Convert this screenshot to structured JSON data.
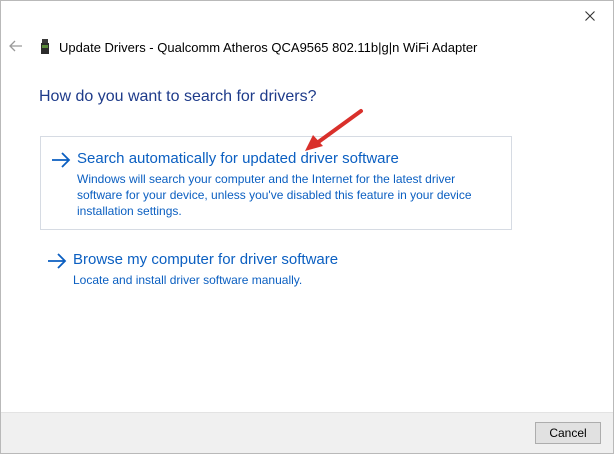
{
  "window": {
    "title": "Update Drivers - Qualcomm Atheros QCA9565 802.11b|g|n WiFi Adapter"
  },
  "heading": "How do you want to search for drivers?",
  "options": [
    {
      "title": "Search automatically for updated driver software",
      "description": "Windows will search your computer and the Internet for the latest driver software for your device, unless you've disabled this feature in your device installation settings."
    },
    {
      "title": "Browse my computer for driver software",
      "description": "Locate and install driver software manually."
    }
  ],
  "footer": {
    "cancel_label": "Cancel"
  },
  "colors": {
    "link_blue": "#0b5fc1",
    "heading_blue": "#1e3b8a",
    "annotation_red": "#d9302b"
  },
  "icons": {
    "close": "close-icon",
    "back": "back-arrow-icon",
    "device": "network-adapter-icon",
    "option_arrow": "right-arrow-icon",
    "annotation": "red-pointer-arrow-icon"
  }
}
